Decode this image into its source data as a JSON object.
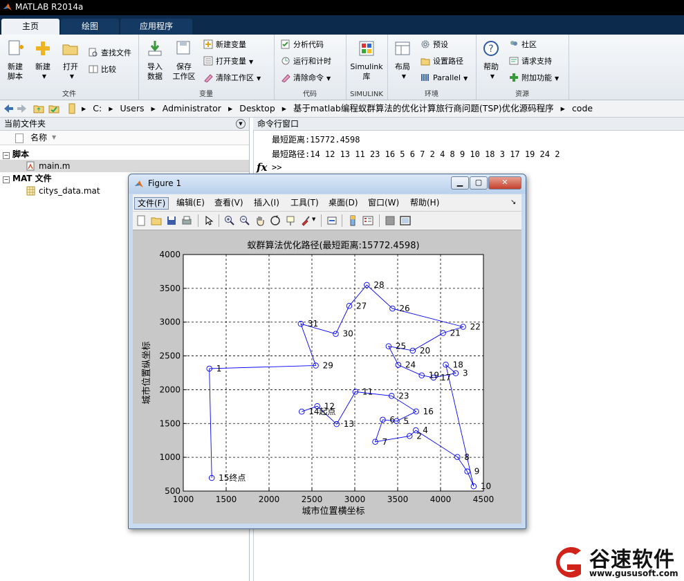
{
  "app": {
    "title": "MATLAB R2014a"
  },
  "tabs": [
    {
      "label": "主页"
    },
    {
      "label": "绘图"
    },
    {
      "label": "应用程序"
    }
  ],
  "ribbon": {
    "file": {
      "label": "文件",
      "new_script_l1": "新建",
      "new_script_l2": "脚本",
      "new": "新建",
      "open": "打开",
      "find_files": "查找文件",
      "compare": "比较"
    },
    "variable": {
      "label": "变量",
      "import_l1": "导入",
      "import_l2": "数据",
      "save_l1": "保存",
      "save_l2": "工作区",
      "new_var": "新建变量",
      "open_var": "打开变量",
      "clear_ws": "清除工作区"
    },
    "code": {
      "label": "代码",
      "analyze": "分析代码",
      "run_time": "运行和计时",
      "clear_cmd": "清除命令"
    },
    "simulink": {
      "label": "SIMULINK",
      "lib_l1": "Simulink",
      "lib_l2": "库"
    },
    "env": {
      "label": "环境",
      "layout": "布局",
      "prefs": "预设",
      "set_path": "设置路径",
      "parallel": "Parallel"
    },
    "res": {
      "label": "资源",
      "help": "帮助",
      "community": "社区",
      "support": "请求支持",
      "addons": "附加功能"
    }
  },
  "address": {
    "segments": [
      "C:",
      "Users",
      "Administrator",
      "Desktop",
      "基于matlab编程蚁群算法的优化计算旅行商问题(TSP)优化源码程序",
      "code"
    ]
  },
  "left_panel": {
    "title": "当前文件夹",
    "col_name": "名称",
    "group_scripts": "脚本",
    "file_main": "main.m",
    "group_mat": "MAT 文件",
    "file_mat": "citys_data.mat"
  },
  "command_window": {
    "title": "命令行窗口",
    "line1": "最短距离:15772.4598",
    "line2": "最短路径:14   12   13   11   23   16    5    6    7    2    4    8    9   10   18    3   17   19   24   2",
    "prompt_fx": "fx",
    "prompt": ">>"
  },
  "figure": {
    "title": "Figure 1",
    "menu": [
      "文件(F)",
      "编辑(E)",
      "查看(V)",
      "插入(I)",
      "工具(T)",
      "桌面(D)",
      "窗口(W)",
      "帮助(H)"
    ]
  },
  "chart_data": {
    "type": "line",
    "title": "蚁群算法优化路径(最短距离:15772.4598)",
    "xlabel": "城市位置横坐标",
    "ylabel": "城市位置纵坐标",
    "xlim": [
      1000,
      4500
    ],
    "ylim": [
      500,
      4000
    ],
    "xticks": [
      1000,
      1500,
      2000,
      2500,
      3000,
      3500,
      4000,
      4500
    ],
    "yticks": [
      500,
      1000,
      1500,
      2000,
      2500,
      3000,
      3500,
      4000
    ],
    "grid": true,
    "line_color": "#0000ff",
    "route_order": [
      14,
      12,
      13,
      11,
      23,
      16,
      5,
      6,
      7,
      2,
      4,
      8,
      9,
      10,
      18,
      3,
      17,
      19,
      24,
      25,
      20,
      21,
      22,
      26,
      28,
      27,
      30,
      31,
      29,
      1,
      15
    ],
    "cities": [
      {
        "id": 1,
        "x": 1304,
        "y": 2312
      },
      {
        "id": 2,
        "x": 3639,
        "y": 1315
      },
      {
        "id": 3,
        "x": 4177,
        "y": 2244
      },
      {
        "id": 4,
        "x": 3712,
        "y": 1399
      },
      {
        "id": 5,
        "x": 3488,
        "y": 1535
      },
      {
        "id": 6,
        "x": 3326,
        "y": 1556
      },
      {
        "id": 7,
        "x": 3238,
        "y": 1229
      },
      {
        "id": 8,
        "x": 4196,
        "y": 1004
      },
      {
        "id": 9,
        "x": 4312,
        "y": 790
      },
      {
        "id": 10,
        "x": 4386,
        "y": 570
      },
      {
        "id": 11,
        "x": 3007,
        "y": 1970
      },
      {
        "id": 12,
        "x": 2562,
        "y": 1756
      },
      {
        "id": 13,
        "x": 2788,
        "y": 1491
      },
      {
        "id": 14,
        "x": 2381,
        "y": 1676
      },
      {
        "id": 15,
        "x": 1332,
        "y": 695
      },
      {
        "id": 16,
        "x": 3715,
        "y": 1678
      },
      {
        "id": 17,
        "x": 3918,
        "y": 2179
      },
      {
        "id": 18,
        "x": 4061,
        "y": 2370
      },
      {
        "id": 19,
        "x": 3780,
        "y": 2212
      },
      {
        "id": 20,
        "x": 3676,
        "y": 2578
      },
      {
        "id": 21,
        "x": 4029,
        "y": 2838
      },
      {
        "id": 22,
        "x": 4263,
        "y": 2931
      },
      {
        "id": 23,
        "x": 3429,
        "y": 1908
      },
      {
        "id": 24,
        "x": 3507,
        "y": 2367
      },
      {
        "id": 25,
        "x": 3394,
        "y": 2643
      },
      {
        "id": 26,
        "x": 3439,
        "y": 3201
      },
      {
        "id": 27,
        "x": 2935,
        "y": 3240
      },
      {
        "id": 28,
        "x": 3140,
        "y": 3550
      },
      {
        "id": 29,
        "x": 2545,
        "y": 2357
      },
      {
        "id": 30,
        "x": 2778,
        "y": 2826
      },
      {
        "id": 31,
        "x": 2370,
        "y": 2975
      }
    ],
    "annotations": {
      "start_label": "起点",
      "end_label": "终点"
    }
  },
  "watermark": {
    "name": "谷速软件",
    "url": "www.gususoft.com"
  }
}
